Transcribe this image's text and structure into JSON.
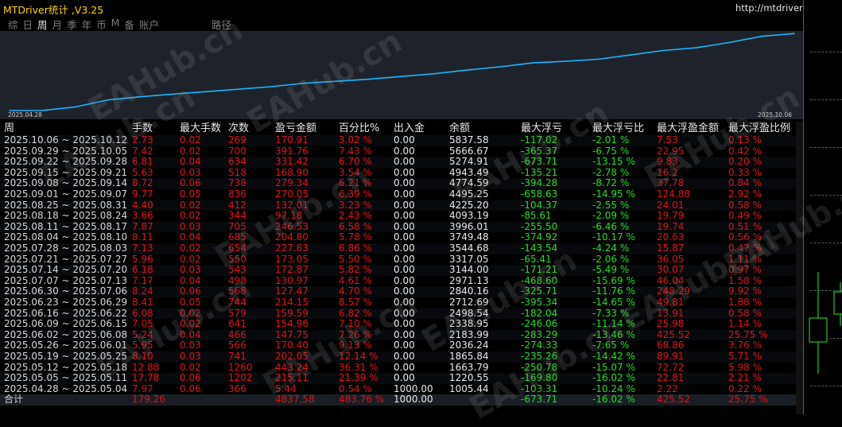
{
  "app": {
    "title": "MTDriver统计 ,V3.25",
    "url": "http://mtdriver.cn"
  },
  "tabs": [
    {
      "label": "综"
    },
    {
      "label": "日"
    },
    {
      "label": "周",
      "active": true
    },
    {
      "label": "月"
    },
    {
      "label": "季"
    },
    {
      "label": "年"
    },
    {
      "label": "币"
    },
    {
      "label": "M"
    },
    {
      "label": "备"
    },
    {
      "label": "账户"
    },
    {
      "label": "路径",
      "gap": true
    }
  ],
  "chart_data": {
    "type": "line",
    "x_start_label": "2025.04.28",
    "x_end_label": "2025.10.06",
    "x": [
      "2025.04.28",
      "2025.05.05",
      "2025.05.12",
      "2025.05.19",
      "2025.05.26",
      "2025.06.02",
      "2025.06.09",
      "2025.06.16",
      "2025.06.23",
      "2025.06.30",
      "2025.07.07",
      "2025.07.14",
      "2025.07.21",
      "2025.07.28",
      "2025.08.04",
      "2025.08.11",
      "2025.08.18",
      "2025.08.25",
      "2025.09.01",
      "2025.09.08",
      "2025.09.15",
      "2025.09.22",
      "2025.09.29",
      "2025.10.06"
    ],
    "series": [
      {
        "values": [
          1000.0,
          1005.44,
          1220.55,
          1663.79,
          1865.84,
          2036.24,
          2183.99,
          2338.95,
          2498.54,
          2712.69,
          2840.16,
          2971.13,
          3144.0,
          3317.05,
          3544.68,
          3749.48,
          3996.01,
          4093.19,
          4225.2,
          4495.25,
          4774.59,
          4943.49,
          5274.91,
          5666.67,
          5837.58
        ]
      }
    ],
    "ylim": [
      1000,
      5900
    ],
    "color": "#1eb4ff"
  },
  "table": {
    "headers": [
      "周",
      "手数",
      "最大手数",
      "次数",
      "盈亏金额",
      "百分比%",
      "出入金",
      "余额",
      "最大浮亏",
      "最大浮亏比",
      "最大浮盈金额",
      "最大浮盈比例"
    ],
    "rows": [
      [
        "2025.10.06 ~ 2025.10.12",
        "2.73",
        "0.02",
        "269",
        "170.91",
        "3.02 %",
        "0.00",
        "5837.58",
        "-117.02",
        "-2.01 %",
        "7.53",
        "0.13 %"
      ],
      [
        "2025.09.29 ~ 2025.10.05",
        "7.42",
        "0.02",
        "700",
        "391.76",
        "7.43 %",
        "0.00",
        "5666.67",
        "-365.37",
        "-6.75 %",
        "22.95",
        "0.42 %"
      ],
      [
        "2025.09.22 ~ 2025.09.28",
        "6.81",
        "0.04",
        "634",
        "331.42",
        "6.70 %",
        "0.00",
        "5274.91",
        "-673.71",
        "-13.15 %",
        "9.83",
        "0.20 %"
      ],
      [
        "2025.09.15 ~ 2025.09.21",
        "5.63",
        "0.03",
        "518",
        "168.90",
        "3.54 %",
        "0.00",
        "4943.49",
        "-135.21",
        "-2.78 %",
        "16.2",
        "0.33 %"
      ],
      [
        "2025.09.08 ~ 2025.09.14",
        "8.72",
        "0.06",
        "738",
        "279.34",
        "6.21 %",
        "0.00",
        "4774.59",
        "-394.28",
        "-8.72 %",
        "37.78",
        "0.84 %"
      ],
      [
        "2025.09.01 ~ 2025.09.07",
        "9.77",
        "0.05",
        "836",
        "270.05",
        "6.39 %",
        "0.00",
        "4495.25",
        "-658.63",
        "-14.95 %",
        "124.88",
        "2.92 %"
      ],
      [
        "2025.08.25 ~ 2025.08.31",
        "4.40",
        "0.02",
        "412",
        "132.01",
        "3.23 %",
        "0.00",
        "4225.20",
        "-104.37",
        "-2.55 %",
        "24.01",
        "0.58 %"
      ],
      [
        "2025.08.18 ~ 2025.08.24",
        "3.66",
        "0.02",
        "344",
        "97.18",
        "2.43 %",
        "0.00",
        "4093.19",
        "-85.61",
        "-2.09 %",
        "19.79",
        "0.49 %"
      ],
      [
        "2025.08.11 ~ 2025.08.17",
        "7.87",
        "0.03",
        "705",
        "246.53",
        "6.58 %",
        "0.00",
        "3996.01",
        "-255.50",
        "-6.46 %",
        "19.74",
        "0.51 %"
      ],
      [
        "2025.08.04 ~ 2025.08.10",
        "8.11",
        "0.04",
        "685",
        "204.80",
        "5.78 %",
        "0.00",
        "3749.48",
        "-374.92",
        "-10.17 %",
        "20.63",
        "0.56 %"
      ],
      [
        "2025.07.28 ~ 2025.08.03",
        "7.13",
        "0.02",
        "654",
        "227.63",
        "6.86 %",
        "0.00",
        "3544.68",
        "-143.54",
        "-4.24 %",
        "15.87",
        "0.47 %"
      ],
      [
        "2025.07.21 ~ 2025.07.27",
        "5.96",
        "0.02",
        "550",
        "173.05",
        "5.50 %",
        "0.00",
        "3317.05",
        "-65.41",
        "-2.06 %",
        "36.05",
        "1.11 %"
      ],
      [
        "2025.07.14 ~ 2025.07.20",
        "6.18",
        "0.03",
        "543",
        "172.87",
        "5.82 %",
        "0.00",
        "3144.00",
        "-171.21",
        "-5.49 %",
        "30.07",
        "0.97 %"
      ],
      [
        "2025.07.07 ~ 2025.07.13",
        "7.17",
        "0.04",
        "498",
        "130.97",
        "4.61 %",
        "0.00",
        "2971.13",
        "-468.60",
        "-15.69 %",
        "46.04",
        "1.58 %"
      ],
      [
        "2025.06.30 ~ 2025.07.06",
        "8.24",
        "0.06",
        "568",
        "127.47",
        "4.70 %",
        "0.00",
        "2840.16",
        "-325.71",
        "-11.76 %",
        "248.29",
        "9.92 %"
      ],
      [
        "2025.06.23 ~ 2025.06.29",
        "8.41",
        "0.05",
        "744",
        "214.15",
        "8.57 %",
        "0.00",
        "2712.69",
        "-395.34",
        "-14.65 %",
        "49.81",
        "1.88 %"
      ],
      [
        "2025.06.16 ~ 2025.06.22",
        "6.08",
        "0.02",
        "579",
        "159.59",
        "6.82 %",
        "0.00",
        "2498.54",
        "-182.04",
        "-7.33 %",
        "13.91",
        "0.58 %"
      ],
      [
        "2025.06.09 ~ 2025.06.15",
        "7.05",
        "0.02",
        "641",
        "154.96",
        "7.10 %",
        "0.00",
        "2338.95",
        "-246.06",
        "-11.14 %",
        "25.98",
        "1.14 %"
      ],
      [
        "2025.06.02 ~ 2025.06.08",
        "5.24",
        "0.04",
        "466",
        "147.75",
        "7.26 %",
        "0.00",
        "2183.99",
        "-283.29",
        "-13.46 %",
        "425.52",
        "25.75 %"
      ],
      [
        "2025.05.26 ~ 2025.06.01",
        "5.95",
        "0.03",
        "566",
        "170.40",
        "9.13 %",
        "0.00",
        "2036.24",
        "-274.33",
        "-7.65 %",
        "68.86",
        "3.76 %"
      ],
      [
        "2025.05.19 ~ 2025.05.25",
        "8.10",
        "0.03",
        "741",
        "202.05",
        "12.14 %",
        "0.00",
        "1865.84",
        "-235.26",
        "-14.42 %",
        "89.91",
        "5.71 %"
      ],
      [
        "2025.05.12 ~ 2025.05.18",
        "12.88",
        "0.02",
        "1260",
        "443.24",
        "36.31 %",
        "0.00",
        "1663.79",
        "-250.78",
        "-15.07 %",
        "72.72",
        "5.98 %"
      ],
      [
        "2025.05.05 ~ 2025.05.11",
        "17.78",
        "0.06",
        "1202",
        "215.11",
        "21.39 %",
        "0.00",
        "1220.55",
        "-169.80",
        "-16.02 %",
        "22.81",
        "2.21 %"
      ],
      [
        "2025.04.28 ~ 2025.05.04",
        "7.97",
        "0.06",
        "366",
        "5.44",
        "0.54 %",
        "1000.00",
        "1005.44",
        "-103.31",
        "-10.24 %",
        "2.22",
        "0.22 %"
      ]
    ],
    "total": [
      "合计",
      "179.26",
      "",
      "",
      "4837.58",
      "483.76 %",
      "1000.00",
      "",
      "-673.71",
      "-16.02 %",
      "425.52",
      "25.75 %"
    ]
  },
  "colors": {
    "title": "#ffd400",
    "line": "#1eb4ff",
    "negative": "#1fe01f",
    "positive": "#e01414"
  },
  "watermark": "EAHub.cn"
}
